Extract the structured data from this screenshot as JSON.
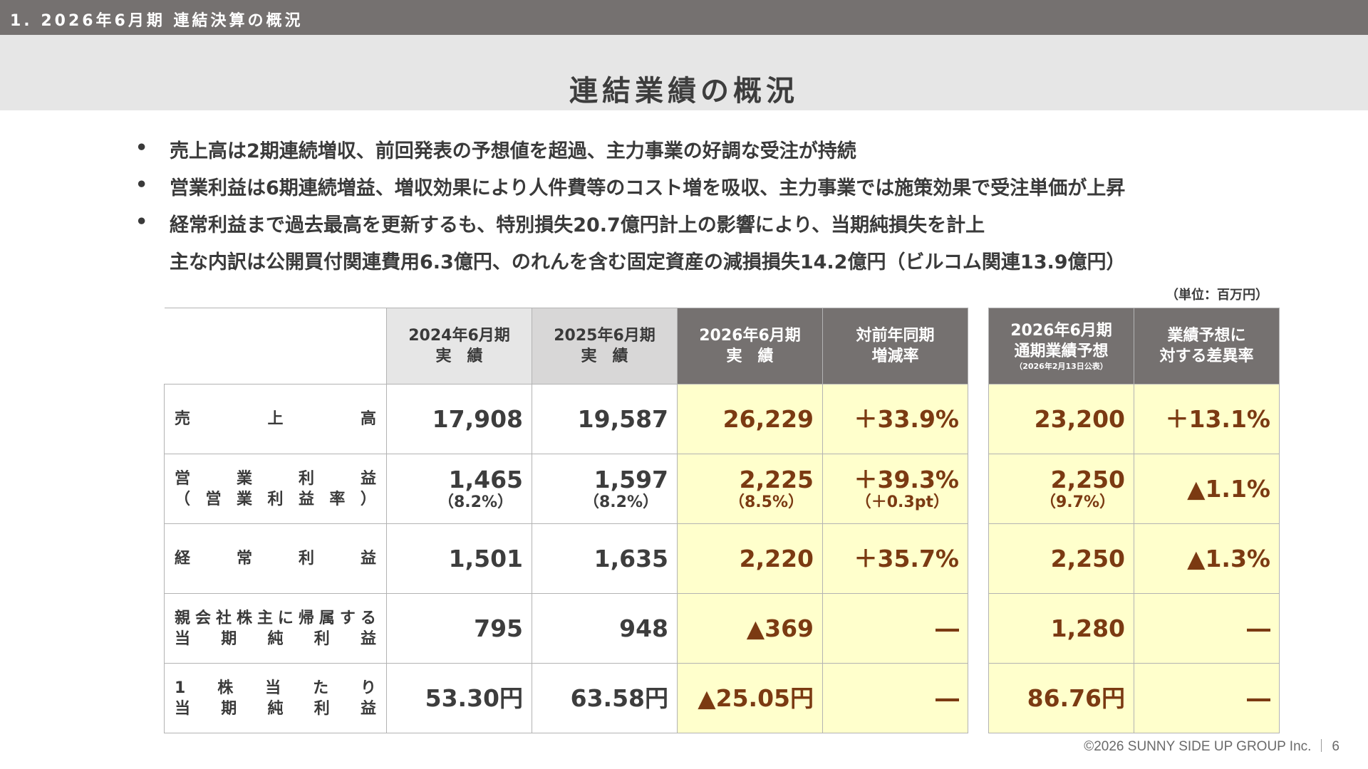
{
  "header": {
    "section": "1. 2026年6月期 連結決算の概況",
    "title": "連結業績の概況"
  },
  "bullets": [
    {
      "marker": "•",
      "text": "売上高は2期連続増収、前回発表の予想値を超過、主力事業の好調な受注が持続"
    },
    {
      "marker": "•",
      "text": "営業利益は6期連続増益、増収効果により人件費等のコスト増を吸収、主力事業では施策効果で受注単価が上昇"
    },
    {
      "marker": "•",
      "text": "経常利益まで過去最高を更新するも、特別損失20.7億円計上の影響により、当期純損失を計上"
    },
    {
      "marker": "",
      "text": "主な内訳は公開買付関連費用6.3億円、のれんを含む固定資産の減損損失14.2億円（ビルコム関連13.9億円）"
    }
  ],
  "unit": "（単位：百万円）",
  "columns": {
    "fy2024": {
      "line1": "2024年6月期",
      "line2": "実　績"
    },
    "fy2025": {
      "line1": "2025年6月期",
      "line2": "実　績"
    },
    "fy2026": {
      "line1": "2026年6月期",
      "line2": "実　績"
    },
    "yoy": {
      "line1": "対前年同期",
      "line2": "増減率"
    },
    "forecast": {
      "line1": "2026年6月期",
      "line2": "通期業績予想",
      "note": "（2026年2月13日公表）"
    },
    "vs_forecast": {
      "line1": "業績予想に",
      "line2": "対する差異率"
    }
  },
  "rows": [
    {
      "label_lines": [
        [
          "売",
          "上",
          "高"
        ]
      ],
      "fy2024": "17,908",
      "fy2024_sub": "",
      "fy2025": "19,587",
      "fy2025_sub": "",
      "fy2026": "26,229",
      "fy2026_sub": "",
      "yoy": "＋33.9%",
      "yoy_sub": "",
      "forecast": "23,200",
      "forecast_sub": "",
      "vs_forecast": "＋13.1%"
    },
    {
      "label_lines": [
        [
          "営",
          "業",
          "利",
          "益"
        ],
        [
          "（",
          "営",
          "業",
          "利",
          "益",
          "率",
          "）"
        ]
      ],
      "fy2024": "1,465",
      "fy2024_sub": "（8.2%）",
      "fy2025": "1,597",
      "fy2025_sub": "（8.2%）",
      "fy2026": "2,225",
      "fy2026_sub": "（8.5%）",
      "yoy": "＋39.3%",
      "yoy_sub": "（＋0.3pt）",
      "forecast": "2,250",
      "forecast_sub": "（9.7%）",
      "vs_forecast": "▲1.1%"
    },
    {
      "label_lines": [
        [
          "経",
          "常",
          "利",
          "益"
        ]
      ],
      "fy2024": "1,501",
      "fy2024_sub": "",
      "fy2025": "1,635",
      "fy2025_sub": "",
      "fy2026": "2,220",
      "fy2026_sub": "",
      "yoy": "＋35.7%",
      "yoy_sub": "",
      "forecast": "2,250",
      "forecast_sub": "",
      "vs_forecast": "▲1.3%"
    },
    {
      "label_lines": [
        [
          "親",
          "会",
          "社",
          "株",
          "主",
          "に",
          "帰",
          "属",
          "す",
          "る"
        ],
        [
          "当",
          "期",
          "純",
          "利",
          "益"
        ]
      ],
      "fy2024": "795",
      "fy2024_sub": "",
      "fy2025": "948",
      "fy2025_sub": "",
      "fy2026": "▲369",
      "fy2026_sub": "",
      "yoy": "―",
      "yoy_sub": "",
      "forecast": "1,280",
      "forecast_sub": "",
      "vs_forecast": "―"
    },
    {
      "label_lines": [
        [
          "1",
          "株",
          "当",
          "た",
          "り"
        ],
        [
          "当",
          "期",
          "純",
          "利",
          "益"
        ]
      ],
      "fy2024": "53.30円",
      "fy2024_sub": "",
      "fy2025": "63.58円",
      "fy2025_sub": "",
      "fy2026": "▲25.05円",
      "fy2026_sub": "",
      "yoy": "―",
      "yoy_sub": "",
      "forecast": "86.76円",
      "forecast_sub": "",
      "vs_forecast": "―"
    }
  ],
  "footer": {
    "copyright": "©2026 SUNNY SIDE UP GROUP Inc.",
    "page": "6"
  },
  "colors": {
    "header_bar": "#757170",
    "title_band": "#e6e6e6",
    "highlight_bg": "#ffffcc",
    "highlight_text": "#7b3a12"
  }
}
